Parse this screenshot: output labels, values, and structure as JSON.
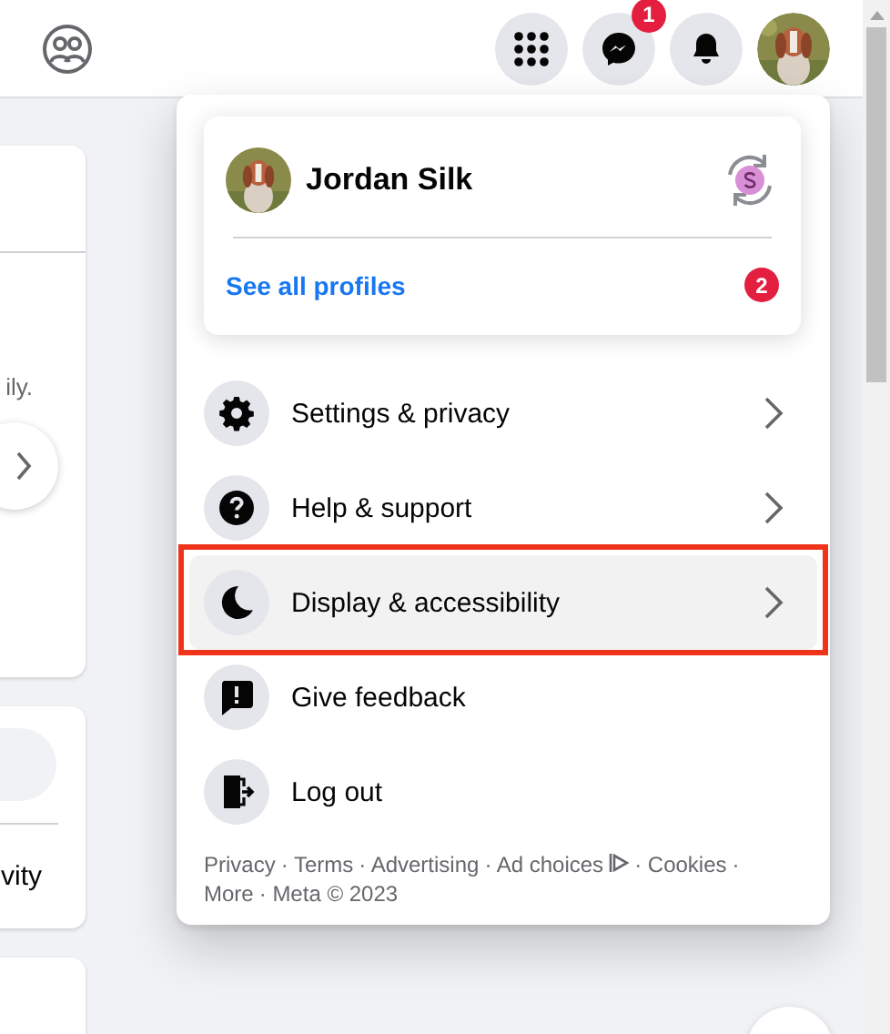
{
  "header": {
    "messenger_badge": "1"
  },
  "left_column": {
    "card_1_text": "ily.",
    "card_2_text": "vity"
  },
  "account_menu": {
    "profile": {
      "name": "Jordan Silk",
      "see_all": "See all profiles",
      "profiles_badge": "2"
    },
    "items": [
      {
        "label": "Settings & privacy",
        "kind": "settings",
        "submenu": true,
        "selected": false
      },
      {
        "label": "Help & support",
        "kind": "help",
        "submenu": true,
        "selected": false
      },
      {
        "label": "Display & accessibility",
        "kind": "display",
        "submenu": true,
        "selected": true
      },
      {
        "label": "Give feedback",
        "kind": "feedback",
        "submenu": false,
        "selected": false
      },
      {
        "label": "Log out",
        "kind": "logout",
        "submenu": false,
        "selected": false
      }
    ],
    "footer": {
      "separator": "·",
      "links": [
        {
          "text": "Privacy",
          "kind": "link"
        },
        {
          "text": "Terms",
          "kind": "link"
        },
        {
          "text": "Advertising",
          "kind": "link"
        },
        {
          "text": "Ad choices",
          "kind": "adchoices"
        },
        {
          "text": "Cookies",
          "kind": "link"
        },
        {
          "text": "More",
          "kind": "link"
        },
        {
          "text": "Meta © 2023",
          "kind": "copyright"
        }
      ]
    }
  }
}
